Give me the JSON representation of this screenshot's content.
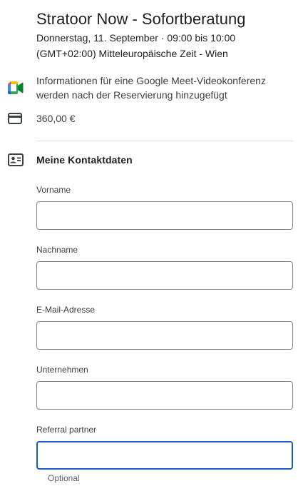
{
  "header": {
    "title": "Stratoor Now - Sofortberatung",
    "date_time": "Donnerstag, 11. September · 09:00 bis 10:00",
    "timezone": "(GMT+02:00) Mitteleuropäische Zeit - Wien"
  },
  "details": {
    "meet_info": "Informationen für eine Google Meet-Videokonferenz werden nach der Reservierung hinzugefügt",
    "price": "360,00 €"
  },
  "contact": {
    "section_title": "Meine Kontaktdaten",
    "fields": [
      {
        "label": "Vorname",
        "value": ""
      },
      {
        "label": "Nachname",
        "value": ""
      },
      {
        "label": "E-Mail-Adresse",
        "value": ""
      },
      {
        "label": "Unternehmen",
        "value": ""
      },
      {
        "label": "Referral partner",
        "value": "",
        "helper": "Optional"
      }
    ]
  },
  "colors": {
    "focus_border": "#1a5bc8",
    "input_border": "#80868b",
    "divider": "#dadce0"
  },
  "icons": {
    "meet": "google-meet-icon",
    "card": "credit-card-icon",
    "contact": "contact-card-icon"
  }
}
